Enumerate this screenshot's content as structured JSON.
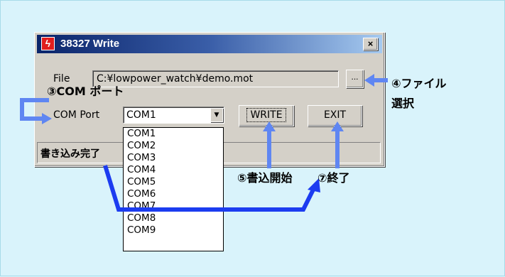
{
  "window": {
    "title": "38327 Write",
    "close_glyph": "×",
    "icon": "lightning-icon"
  },
  "file": {
    "label": "File",
    "value": "C:¥lowpower_watch¥demo.mot",
    "browse_label": "..."
  },
  "com": {
    "label": "COM Port",
    "selected": "COM1",
    "options": [
      "COM1",
      "COM2",
      "COM3",
      "COM4",
      "COM5",
      "COM6",
      "COM7",
      "COM8",
      "COM9"
    ]
  },
  "buttons": {
    "write": "WRITE",
    "exit": "EXIT"
  },
  "status": {
    "text": "書き込み完了"
  },
  "annotations": {
    "com_port": "③COM ポート",
    "file_select_line1": "④ファイル",
    "file_select_line2": "選択",
    "write_start": "⑤書込開始",
    "exit_label": "⑦終了"
  },
  "colors": {
    "background": "#d9f3fb",
    "arrow_blue": "#1c3cf0",
    "arrow_light": "#5f86f2",
    "title_dark": "#0a246a"
  }
}
